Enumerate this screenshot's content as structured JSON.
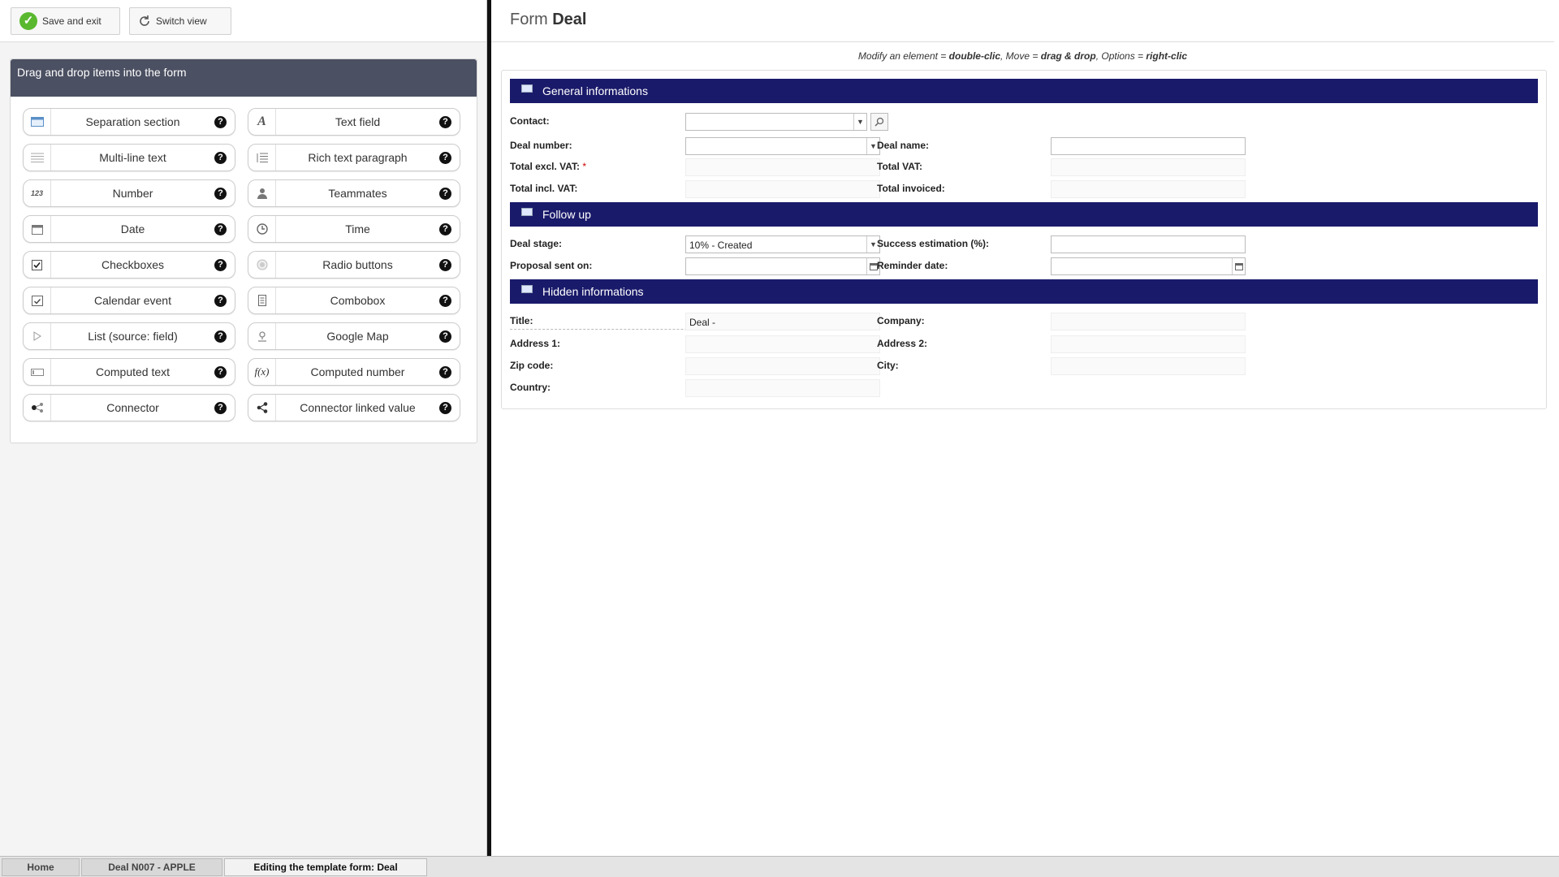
{
  "toolbar": {
    "save_label": "Save and exit",
    "switch_label": "Switch view"
  },
  "palette": {
    "title": "Drag and drop items into the form",
    "items": [
      {
        "label": "Separation section",
        "icon": "section-icon"
      },
      {
        "label": "Text field",
        "icon": "text-field-icon"
      },
      {
        "label": "Multi-line text",
        "icon": "multiline-icon"
      },
      {
        "label": "Rich text paragraph",
        "icon": "rich-text-icon"
      },
      {
        "label": "Number",
        "icon": "number-icon"
      },
      {
        "label": "Teammates",
        "icon": "user-icon"
      },
      {
        "label": "Date",
        "icon": "calendar-icon"
      },
      {
        "label": "Time",
        "icon": "clock-icon"
      },
      {
        "label": "Checkboxes",
        "icon": "checkbox-icon"
      },
      {
        "label": "Radio buttons",
        "icon": "radio-icon"
      },
      {
        "label": "Calendar event",
        "icon": "calendar-event-icon"
      },
      {
        "label": "Combobox",
        "icon": "combobox-icon"
      },
      {
        "label": "List (source: field)",
        "icon": "list-arrow-icon"
      },
      {
        "label": "Google Map",
        "icon": "map-pin-icon"
      },
      {
        "label": "Computed text",
        "icon": "computed-text-icon"
      },
      {
        "label": "Computed number",
        "icon": "function-icon"
      },
      {
        "label": "Connector",
        "icon": "connector-icon"
      },
      {
        "label": "Connector linked value",
        "icon": "share-icon"
      }
    ],
    "help_glyph": "?"
  },
  "form": {
    "title_prefix": "Form",
    "title_name": "Deal",
    "hint": {
      "t1": "Modify an element = ",
      "b1": "double-clic",
      "t2": ", Move = ",
      "b2": "drag & drop",
      "t3": ", Options = ",
      "b3": "right-clic"
    },
    "sections": {
      "general": "General informations",
      "follow": "Follow up",
      "hidden": "Hidden informations"
    },
    "fields": {
      "contact": "Contact:",
      "deal_number": "Deal number:",
      "deal_name": "Deal name:",
      "total_excl": "Total excl. VAT:",
      "total_excl_req": "*",
      "total_vat": "Total VAT:",
      "total_incl": "Total incl. VAT:",
      "total_invoiced": "Total invoiced:",
      "deal_stage": "Deal stage:",
      "deal_stage_value": "10% - Created",
      "success_est": "Success estimation (%):",
      "proposal_sent": "Proposal sent on:",
      "reminder_date": "Reminder date:",
      "title": "Title:",
      "title_value": "Deal  -",
      "company": "Company:",
      "address1": "Address 1:",
      "address2": "Address 2:",
      "zip": "Zip code:",
      "city": "City:",
      "country": "Country:"
    }
  },
  "taskbar": {
    "tabs": [
      "Home",
      "Deal N007 - APPLE",
      "Editing the template form: Deal"
    ]
  }
}
